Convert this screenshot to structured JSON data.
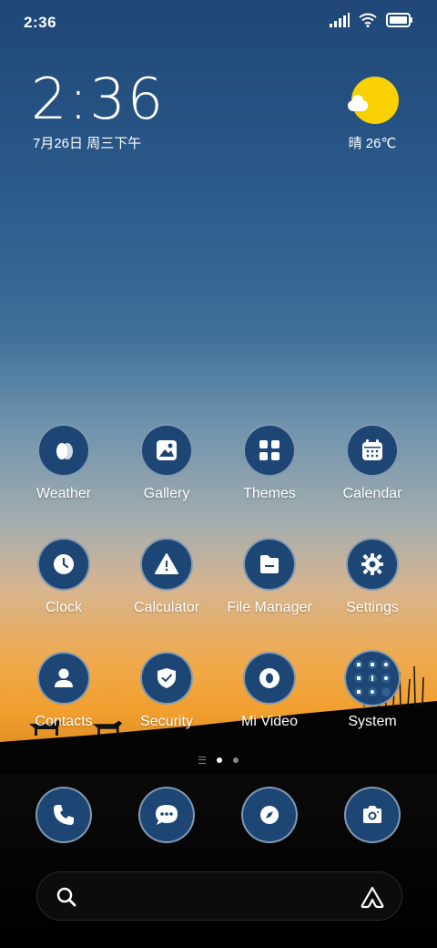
{
  "status_bar": {
    "time": "2:36",
    "icons": [
      "signal-icon",
      "wifi-icon",
      "battery-icon"
    ]
  },
  "clock_widget": {
    "time": "2:36",
    "date": "7月26日 周三下午"
  },
  "weather_widget": {
    "text": "晴 26℃",
    "icon": "sunny-cloud-icon"
  },
  "apps": [
    {
      "id": "weather",
      "label": "Weather",
      "icon": "weather-icon"
    },
    {
      "id": "gallery",
      "label": "Gallery",
      "icon": "gallery-icon"
    },
    {
      "id": "themes",
      "label": "Themes",
      "icon": "themes-icon"
    },
    {
      "id": "calendar",
      "label": "Calendar",
      "icon": "calendar-icon"
    },
    {
      "id": "clock",
      "label": "Clock",
      "icon": "clock-icon"
    },
    {
      "id": "calculator",
      "label": "Calculator",
      "icon": "warning-icon"
    },
    {
      "id": "file-manager",
      "label": "File Manager",
      "icon": "folder-icon"
    },
    {
      "id": "settings",
      "label": "Settings",
      "icon": "gear-icon"
    },
    {
      "id": "contacts",
      "label": "Contacts",
      "icon": "person-icon"
    },
    {
      "id": "security",
      "label": "Security",
      "icon": "shield-icon"
    },
    {
      "id": "mi-video",
      "label": "Mi Video",
      "icon": "video-icon"
    },
    {
      "id": "system",
      "label": "System",
      "icon": "folder-grid-icon"
    }
  ],
  "page_indicator": {
    "pages": 2,
    "active": 0
  },
  "dock": [
    {
      "id": "phone",
      "icon": "phone-icon"
    },
    {
      "id": "messages",
      "icon": "message-icon"
    },
    {
      "id": "browser",
      "icon": "compass-icon"
    },
    {
      "id": "camera",
      "icon": "camera-icon"
    }
  ],
  "search_bar": {
    "left_icon": "search-icon",
    "right_icon": "assistant-icon"
  },
  "colors": {
    "icon_bg": "#1d4674",
    "sun": "#fad105"
  }
}
